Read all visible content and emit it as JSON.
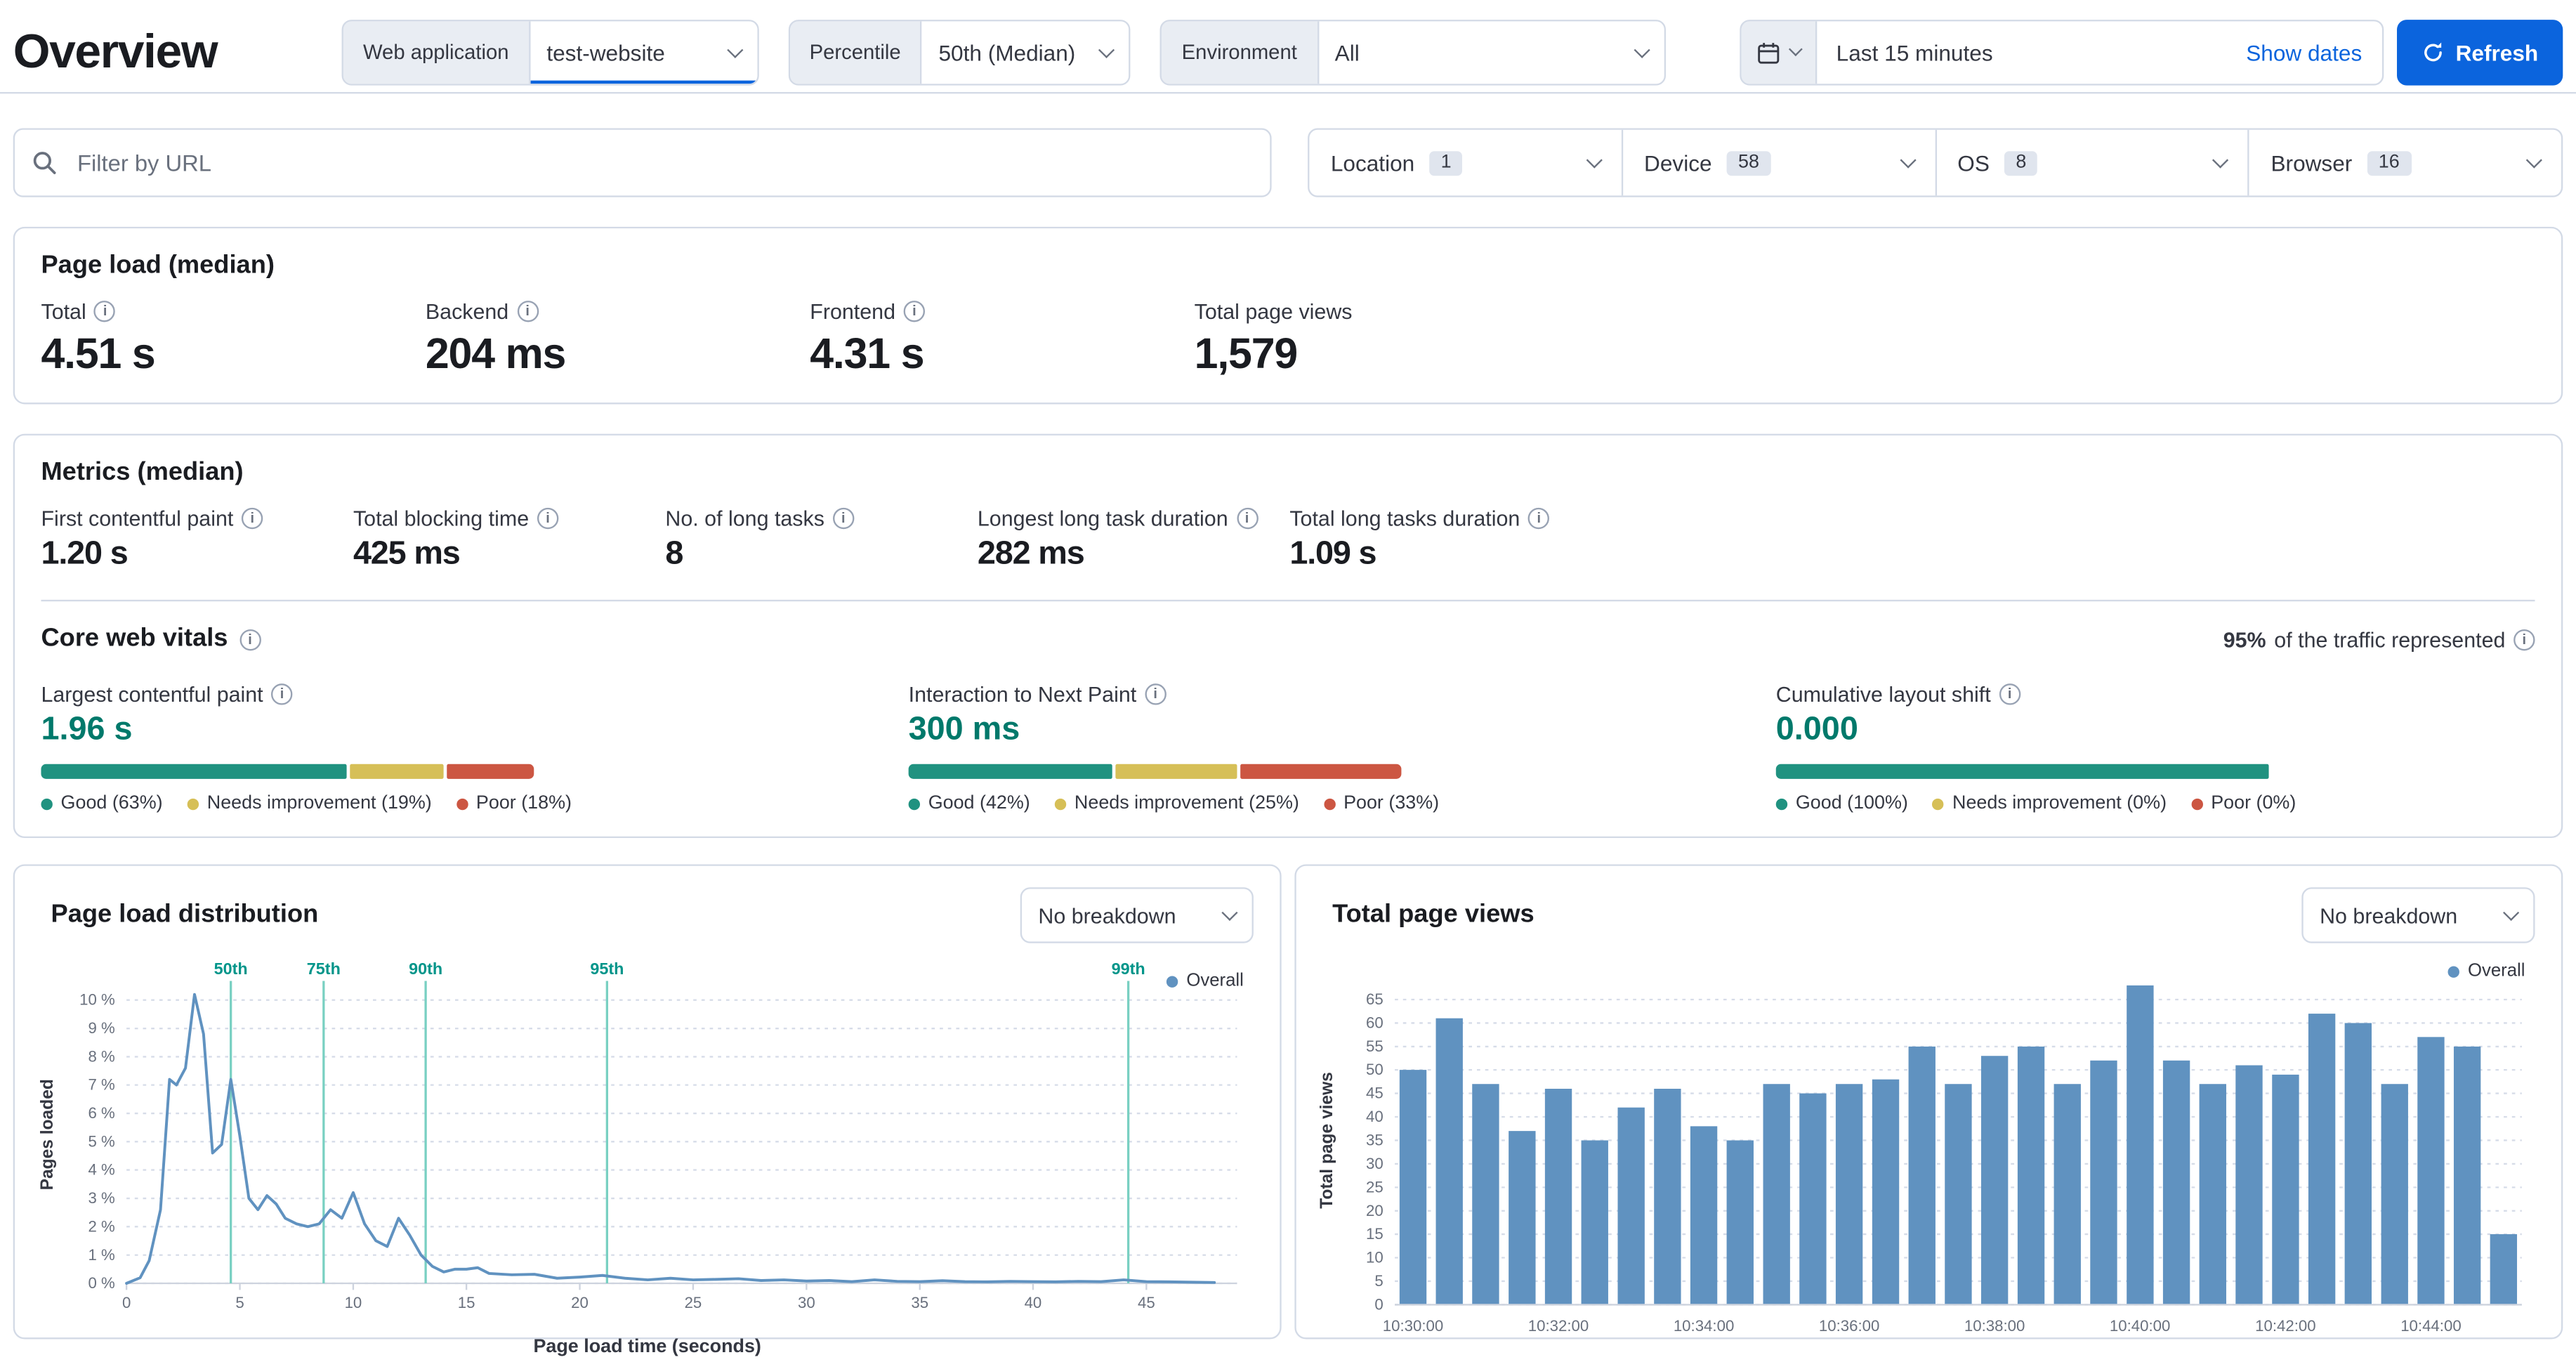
{
  "colors": {
    "accent_blue": "#0b64dd",
    "teal_value": "#00796b",
    "good_green": "#209280",
    "needs_improvement_yellow": "#d6bf57",
    "poor_red": "#cc5642",
    "chart_blue": "#6092c0",
    "percentile_marker": "#79d0c2",
    "percentile_label": "#00958a"
  },
  "page": {
    "title": "Overview"
  },
  "toolbar": {
    "web_app_label": "Web application",
    "web_app_value": "test-website",
    "percentile_label": "Percentile",
    "percentile_value": "50th (Median)",
    "environment_label": "Environment",
    "environment_value": "All",
    "time_range": "Last 15 minutes",
    "show_dates_label": "Show dates",
    "refresh_label": "Refresh"
  },
  "filters": {
    "url_filter_placeholder": "Filter by URL",
    "dropdowns": [
      {
        "label": "Location",
        "count": "1"
      },
      {
        "label": "Device",
        "count": "58"
      },
      {
        "label": "OS",
        "count": "8"
      },
      {
        "label": "Browser",
        "count": "16"
      }
    ]
  },
  "page_load_card": {
    "title": "Page load (median)",
    "stats": [
      {
        "label": "Total",
        "value": "4.51 s"
      },
      {
        "label": "Backend",
        "value": "204 ms"
      },
      {
        "label": "Frontend",
        "value": "4.31 s"
      },
      {
        "label": "Total page views",
        "value": "1,579"
      }
    ]
  },
  "metrics_card": {
    "title": "Metrics (median)",
    "stats": [
      {
        "label": "First contentful paint",
        "value": "1.20 s"
      },
      {
        "label": "Total blocking time",
        "value": "425 ms"
      },
      {
        "label": "No. of long tasks",
        "value": "8"
      },
      {
        "label": "Longest long task duration",
        "value": "282 ms"
      },
      {
        "label": "Total long tasks duration",
        "value": "1.09 s"
      }
    ],
    "core_web_vitals": {
      "title": "Core web vitals",
      "traffic_percent": "95%",
      "traffic_text": " of the traffic represented",
      "vitals": [
        {
          "label": "Largest contentful paint",
          "value": "1.96 s",
          "good_pct": 63,
          "ni_pct": 19,
          "poor_pct": 18,
          "legend": [
            "Good (63%)",
            "Needs improvement (19%)",
            "Poor (18%)"
          ]
        },
        {
          "label": "Interaction to Next Paint",
          "value": "300 ms",
          "good_pct": 42,
          "ni_pct": 25,
          "poor_pct": 33,
          "legend": [
            "Good (42%)",
            "Needs improvement (25%)",
            "Poor (33%)"
          ]
        },
        {
          "label": "Cumulative layout shift",
          "value": "0.000",
          "good_pct": 100,
          "ni_pct": 0,
          "poor_pct": 0,
          "legend": [
            "Good (100%)",
            "Needs improvement (0%)",
            "Poor (0%)"
          ]
        }
      ]
    }
  },
  "distribution_card": {
    "title": "Page load distribution",
    "breakdown_value": "No breakdown",
    "legend": "Overall"
  },
  "page_views_card": {
    "title": "Total page views",
    "breakdown_value": "No breakdown",
    "legend": "Overall"
  },
  "chart_data": [
    {
      "type": "line",
      "title": "Page load distribution",
      "xlabel": "Page load time (seconds)",
      "ylabel": "Pages loaded",
      "xlim": [
        0,
        49
      ],
      "ylim": [
        0,
        10.5
      ],
      "x_ticks": [
        0,
        5,
        10,
        15,
        20,
        25,
        30,
        35,
        40,
        45
      ],
      "y_ticks": [
        0,
        1,
        2,
        3,
        4,
        5,
        6,
        7,
        8,
        9,
        10
      ],
      "y_tick_suffix": " %",
      "grid": true,
      "legend": [
        "Overall"
      ],
      "legend_position": "top-right",
      "line_color": "#6092c0",
      "marker_color": "#79d0c2",
      "marker_label_color": "#00958a",
      "percentile_markers": [
        {
          "label": "50th",
          "x": 4.6
        },
        {
          "label": "75th",
          "x": 8.7
        },
        {
          "label": "90th",
          "x": 13.2
        },
        {
          "label": "95th",
          "x": 21.2
        },
        {
          "label": "99th",
          "x": 44.2
        }
      ],
      "points": [
        [
          0,
          0
        ],
        [
          0.6,
          0.2
        ],
        [
          1,
          0.8
        ],
        [
          1.5,
          2.6
        ],
        [
          1.9,
          7.2
        ],
        [
          2.2,
          7.0
        ],
        [
          2.6,
          7.6
        ],
        [
          3,
          10.2
        ],
        [
          3.4,
          8.8
        ],
        [
          3.8,
          4.6
        ],
        [
          4.2,
          4.9
        ],
        [
          4.6,
          7.2
        ],
        [
          5,
          5.2
        ],
        [
          5.4,
          3.0
        ],
        [
          5.8,
          2.6
        ],
        [
          6.2,
          3.1
        ],
        [
          6.6,
          2.8
        ],
        [
          7,
          2.3
        ],
        [
          7.5,
          2.1
        ],
        [
          8,
          2.0
        ],
        [
          8.5,
          2.1
        ],
        [
          9,
          2.6
        ],
        [
          9.5,
          2.3
        ],
        [
          10,
          3.2
        ],
        [
          10.5,
          2.1
        ],
        [
          11,
          1.5
        ],
        [
          11.5,
          1.3
        ],
        [
          12,
          2.3
        ],
        [
          12.5,
          1.7
        ],
        [
          13,
          1.0
        ],
        [
          13.5,
          0.6
        ],
        [
          14,
          0.4
        ],
        [
          14.5,
          0.5
        ],
        [
          15,
          0.5
        ],
        [
          15.5,
          0.55
        ],
        [
          16,
          0.35
        ],
        [
          17,
          0.3
        ],
        [
          18,
          0.32
        ],
        [
          19,
          0.18
        ],
        [
          20,
          0.22
        ],
        [
          21,
          0.28
        ],
        [
          22,
          0.18
        ],
        [
          23,
          0.12
        ],
        [
          24,
          0.18
        ],
        [
          25,
          0.12
        ],
        [
          26,
          0.14
        ],
        [
          27,
          0.16
        ],
        [
          28,
          0.1
        ],
        [
          29,
          0.12
        ],
        [
          30,
          0.08
        ],
        [
          31,
          0.1
        ],
        [
          32,
          0.06
        ],
        [
          33,
          0.12
        ],
        [
          34,
          0.07
        ],
        [
          35,
          0.06
        ],
        [
          36,
          0.09
        ],
        [
          37,
          0.06
        ],
        [
          38,
          0.05
        ],
        [
          39,
          0.07
        ],
        [
          40,
          0.06
        ],
        [
          41,
          0.05
        ],
        [
          42,
          0.07
        ],
        [
          43,
          0.06
        ],
        [
          44,
          0.12
        ],
        [
          45,
          0.06
        ],
        [
          46,
          0.05
        ],
        [
          47,
          0.04
        ],
        [
          48,
          0.03
        ]
      ]
    },
    {
      "type": "bar",
      "title": "Total page views",
      "ylabel": "Total page views",
      "xlabel": "",
      "interval_seconds": 30,
      "ylim": [
        0,
        70
      ],
      "y_ticks": [
        0,
        5,
        10,
        15,
        20,
        25,
        30,
        35,
        40,
        45,
        50,
        55,
        60,
        65
      ],
      "grid": true,
      "legend": [
        "Overall"
      ],
      "legend_position": "top-right",
      "bar_color": "#6092c0",
      "x_ticks": [
        {
          "index": 0,
          "label": "10:30:00"
        },
        {
          "index": 4,
          "label": "10:32:00"
        },
        {
          "index": 8,
          "label": "10:34:00"
        },
        {
          "index": 12,
          "label": "10:36:00"
        },
        {
          "index": 16,
          "label": "10:38:00"
        },
        {
          "index": 20,
          "label": "10:40:00"
        },
        {
          "index": 24,
          "label": "10:42:00"
        },
        {
          "index": 28,
          "label": "10:44:00"
        }
      ],
      "values": [
        50,
        61,
        47,
        37,
        46,
        35,
        42,
        46,
        38,
        35,
        47,
        45,
        47,
        48,
        55,
        47,
        53,
        55,
        47,
        52,
        68,
        52,
        47,
        51,
        49,
        62,
        60,
        47,
        57,
        55,
        15
      ]
    }
  ]
}
